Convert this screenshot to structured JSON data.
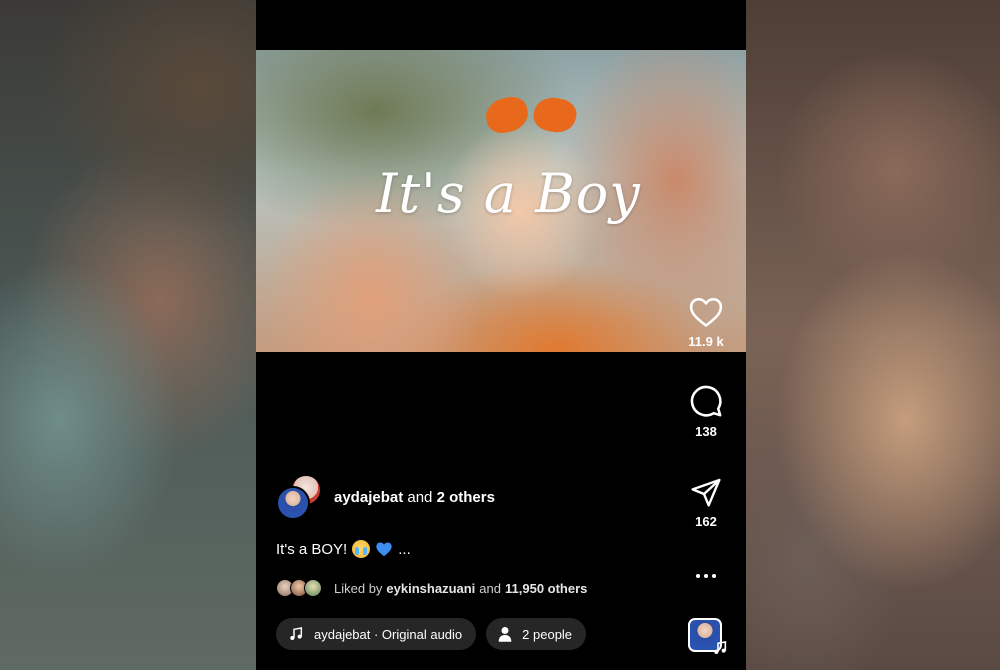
{
  "media": {
    "overlay_text": "It's a Boy"
  },
  "actions": {
    "like_count": "11.9 k",
    "comment_count": "138",
    "share_count": "162"
  },
  "author": {
    "username": "aydajebat",
    "joiner": "and",
    "collaborators": "2 others"
  },
  "caption": {
    "text": "It's a BOY!",
    "more": "..."
  },
  "likes": {
    "prefix": "Liked by",
    "user": "eykinshazuani",
    "joiner": "and",
    "others": "11,950 others"
  },
  "audio_chip": {
    "label": "aydajebat · Original audio"
  },
  "people_chip": {
    "label": "2 people"
  },
  "colors": {
    "background": "#000000",
    "chip": "#262626",
    "bow": "#e8691c"
  }
}
